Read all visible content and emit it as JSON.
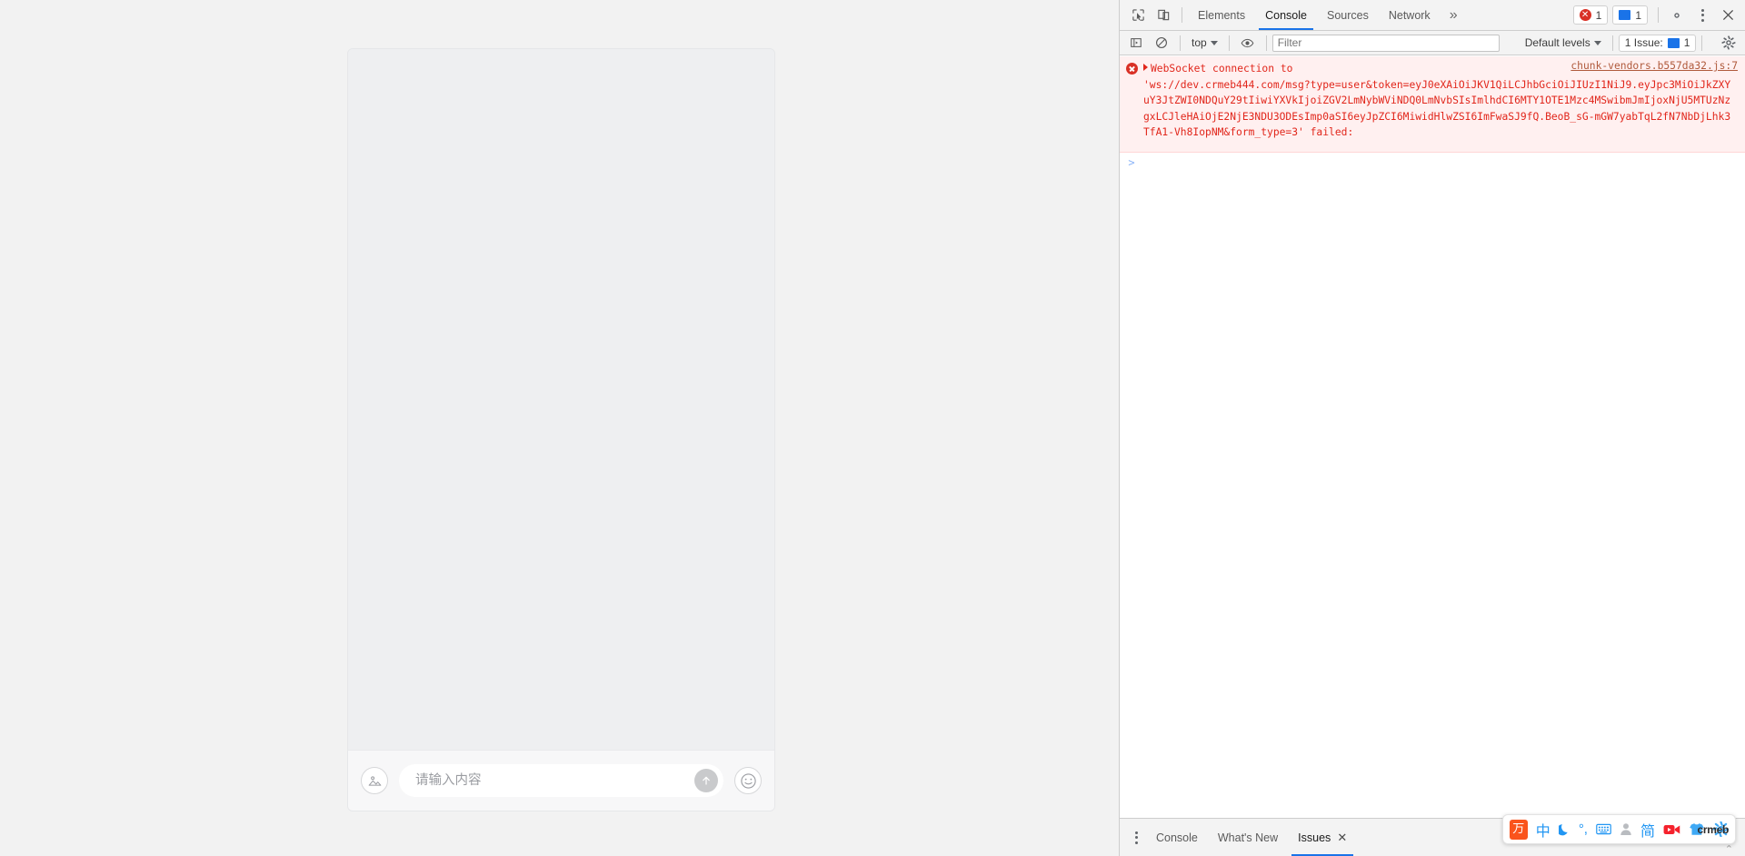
{
  "page": {
    "chat": {
      "input_placeholder": "请输入内容",
      "input_value": "",
      "image_button_label": "image-upload",
      "send_button_label": "send",
      "emoji_button_label": "emoji"
    }
  },
  "devtools": {
    "tabs": [
      {
        "label": "Elements",
        "active": false
      },
      {
        "label": "Console",
        "active": true
      },
      {
        "label": "Sources",
        "active": false
      },
      {
        "label": "Network",
        "active": false
      }
    ],
    "more_tabs_label": "»",
    "error_badge_count": "1",
    "message_badge_count": "1",
    "settings_label": "Settings",
    "more_options_label": "More options",
    "close_label": "Close DevTools",
    "toolbar": {
      "context_selector": "top",
      "filter_placeholder": "Filter",
      "filter_value": "",
      "levels_selector": "Default levels",
      "issues_chip_label": "1 Issue:",
      "issues_chip_count": "1",
      "console_settings_label": "Console settings"
    },
    "console": {
      "error": {
        "line1": "WebSocket connection to",
        "line2": "'ws://dev.crmeb444.com/msg?",
        "line3": "type=user&token=eyJ0eXAiOiJKV1QiLCJhbGciOiJIUzI1NiJ9.eyJpc3MiOiJkZXYuY3JtZWI0NDQuY29tIiwiYXVkIjoiZGV2LmNybWViNDQ0LmNvbSIsImlhdCI6MTY1OTE1Mzc4MSwibmJmIjoxNjU5MTUzNzgxLCJleHAiOjE2NjE3NDU3ODEsImp0aSI6eyJpZCI6MiwidHlwZSI6ImFwaSJ9fQ.BeoB_sG-mGW7yabTqL2fN7NbDjLhk3TfA1-Vh8IopNM&form_type=3' failed:",
        "source_link": "chunk-vendors.b557da32.js:7"
      },
      "prompt_symbol": ">"
    },
    "drawer": {
      "tabs": [
        {
          "label": "Console",
          "active": false,
          "closable": false
        },
        {
          "label": "What's New",
          "active": false,
          "closable": false
        },
        {
          "label": "Issues",
          "active": true,
          "closable": true
        }
      ],
      "more_tools_label": "More tools"
    }
  },
  "ime": {
    "logo_glyph": "万",
    "items": [
      {
        "name": "chinese-mode",
        "glyph": "中"
      },
      {
        "name": "moon",
        "glyph": "☽"
      },
      {
        "name": "punctuation",
        "glyph": "°,"
      },
      {
        "name": "keyboard",
        "glyph": "⌨"
      },
      {
        "name": "user",
        "glyph": "●"
      },
      {
        "name": "simplified",
        "glyph": "简"
      },
      {
        "name": "video",
        "glyph": "▶"
      },
      {
        "name": "skin",
        "glyph": "☗"
      },
      {
        "name": "settings",
        "glyph": "⚙"
      }
    ],
    "watermark": "crmeb",
    "collapse_glyph": "⌃"
  },
  "colors": {
    "accent_blue": "#1a73e8",
    "error_red": "#d93025",
    "error_bg": "#fff0f0",
    "error_text": "#e1261b",
    "ime_orange": "#fa541c"
  }
}
